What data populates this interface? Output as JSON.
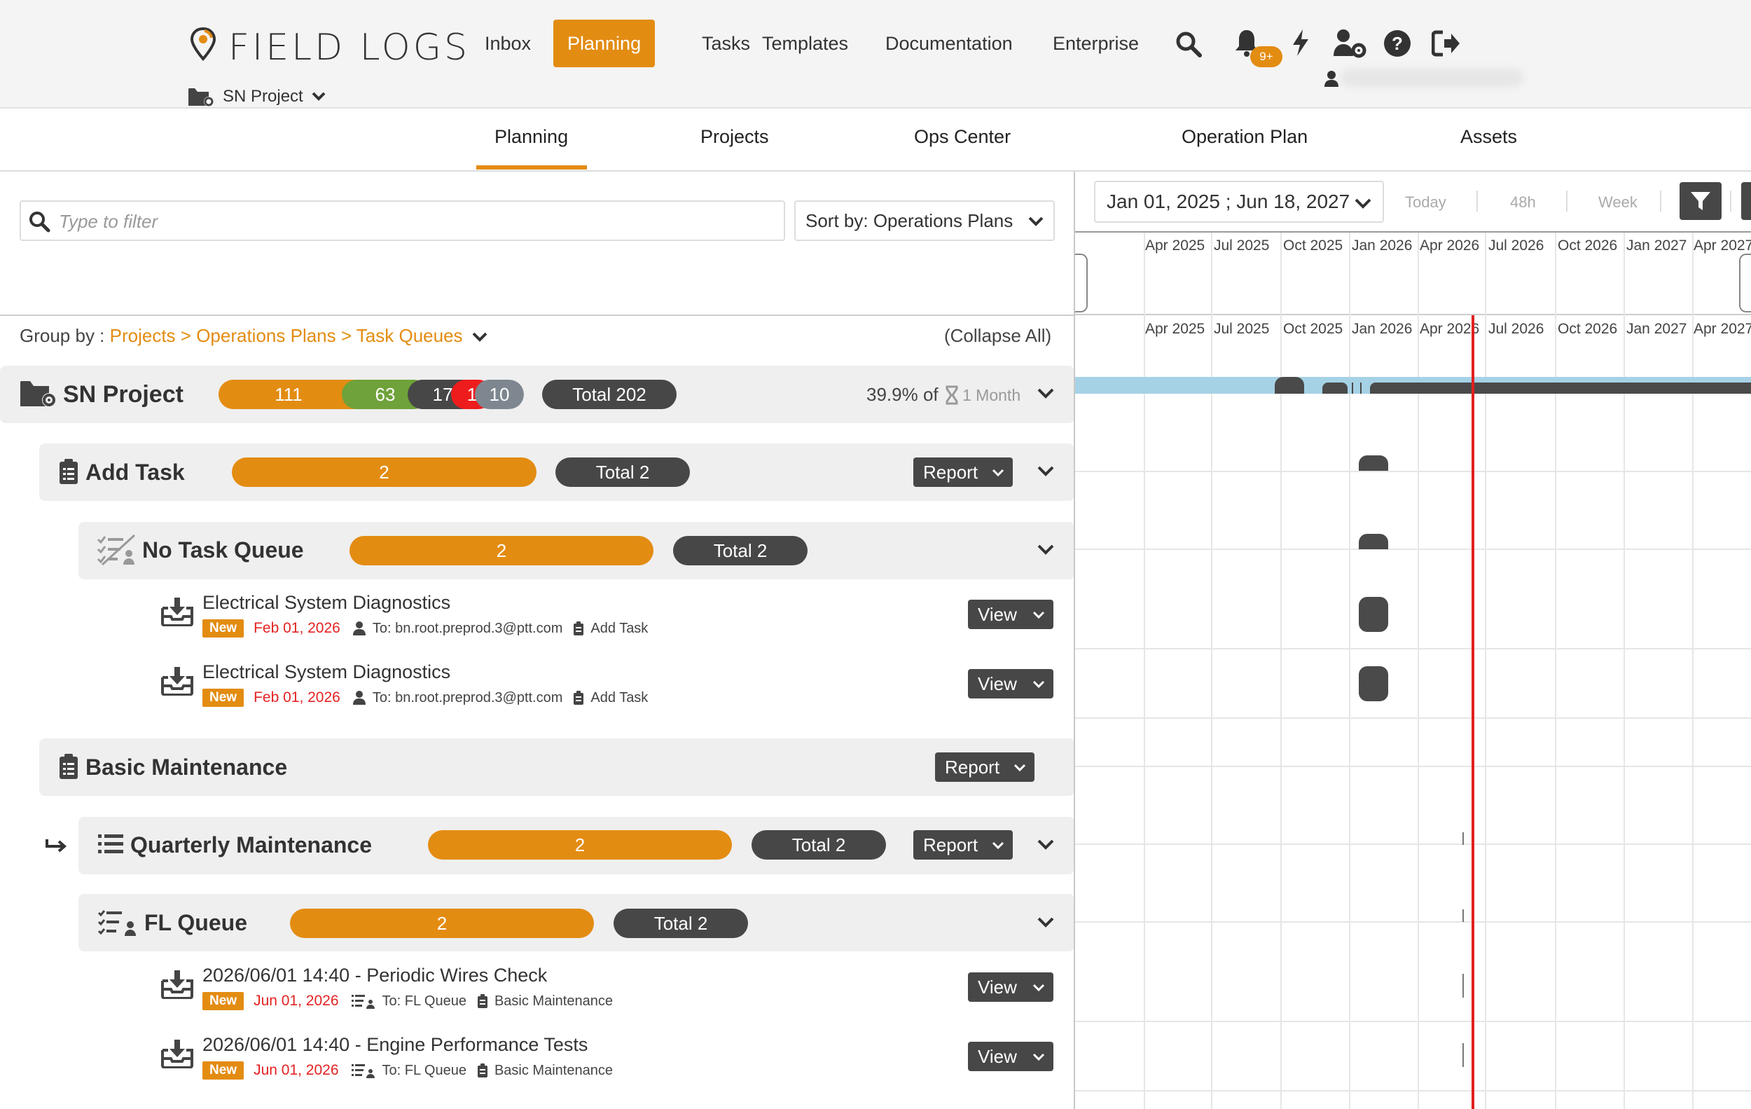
{
  "app": {
    "brand": "FIELD LOGS",
    "project_switcher": "SN Project",
    "notification_badge": "9+",
    "accent_color": "#e38c12"
  },
  "nav": {
    "items": [
      "Inbox",
      "Planning",
      "Tasks",
      "Templates",
      "Documentation",
      "Enterprise"
    ],
    "active": "Planning"
  },
  "subnav": {
    "items": [
      "Planning",
      "Projects",
      "Ops Center",
      "Operation Plan",
      "Assets"
    ],
    "active": "Planning"
  },
  "toolbar": {
    "filter_placeholder": "Type to filter",
    "sort_label": "Sort by: Operations Plans"
  },
  "groupby": {
    "label": "Group by :",
    "crumbs": "Projects > Operations Plans > Task Queues",
    "collapse_all": "(Collapse All)"
  },
  "project": {
    "name": "SN Project",
    "counts": [
      "111",
      "63",
      "17",
      "1",
      "10"
    ],
    "total": "Total 202",
    "progress_prefix": "39.9% of",
    "progress_duration": "1 Month"
  },
  "groups": {
    "add_task": {
      "title": "Add Task",
      "count": "2",
      "total": "Total 2",
      "report": "Report"
    },
    "no_task_queue": {
      "title": "No Task Queue",
      "count": "2",
      "total": "Total 2"
    },
    "basic_maintenance": {
      "title": "Basic Maintenance",
      "report": "Report"
    },
    "quarterly_maintenance": {
      "title": "Quarterly Maintenance",
      "count": "2",
      "total": "Total 2",
      "report": "Report"
    },
    "fl_queue": {
      "title": "FL Queue",
      "count": "2",
      "total": "Total 2"
    }
  },
  "tasks": [
    {
      "title": "Electrical System Diagnostics",
      "status": "New",
      "date": "Feb 01, 2026",
      "assignee": "To: bn.root.preprod.3@ptt.com",
      "plan": "Add Task",
      "action": "View"
    },
    {
      "title": "Electrical System Diagnostics",
      "status": "New",
      "date": "Feb 01, 2026",
      "assignee": "To: bn.root.preprod.3@ptt.com",
      "plan": "Add Task",
      "action": "View"
    },
    {
      "title": "2026/06/01 14:40 - Periodic Wires Check",
      "status": "New",
      "date": "Jun 01, 2026",
      "assignee": "To: FL Queue",
      "plan": "Basic Maintenance",
      "action": "View"
    },
    {
      "title": "2026/06/01 14:40 - Engine Performance Tests",
      "status": "New",
      "date": "Jun 01, 2026",
      "assignee": "To: FL Queue",
      "plan": "Basic Maintenance",
      "action": "View"
    }
  ],
  "timeline": {
    "date_range": "Jan 01, 2025 ; Jun 18, 2027",
    "buttons": [
      "Today",
      "48h",
      "Week"
    ],
    "months": [
      "Apr 2025",
      "Jul 2025",
      "Oct 2025",
      "Jan 2026",
      "Apr 2026",
      "Jul 2026",
      "Oct 2026",
      "Jan 2027",
      "Apr 2027"
    ]
  }
}
